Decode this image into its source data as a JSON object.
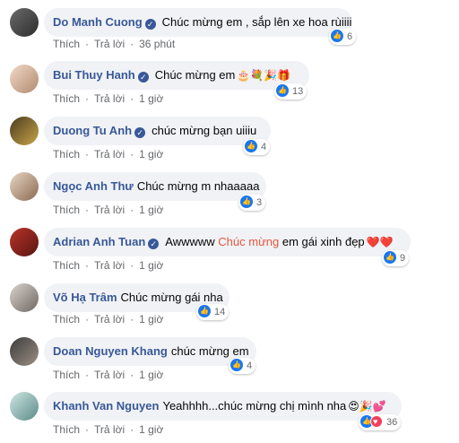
{
  "actions": {
    "like_label": "Thích",
    "reply_label": "Trả lời",
    "separator": "·"
  },
  "comments": [
    {
      "name": "Do Manh Cuong",
      "verified": true,
      "text": "Chúc mừng em , sắp lên xe hoa rùiiii",
      "emojis": "",
      "reactions": "6",
      "time": "36 phút"
    },
    {
      "name": "Bui Thuy Hanh",
      "verified": true,
      "text": "Chúc mừng em",
      "emojis": "🎂💐🎉🎁",
      "reactions": "13",
      "time": "1 giờ"
    },
    {
      "name": "Duong Tu Anh",
      "verified": true,
      "text": "chúc mừng bạn uiiiu",
      "emojis": "",
      "reactions": "4",
      "time": "1 giờ"
    },
    {
      "name": "Ngọc Anh Thư",
      "verified": false,
      "text": "Chúc mừng m nhaaaaa",
      "emojis": "",
      "reactions": "3",
      "time": "1 giờ"
    },
    {
      "name": "Adrian Anh Tuan",
      "verified": true,
      "text_before": "Awwwww",
      "text_highlight": "Chúc mừng",
      "text_after": "em gái xinh đẹp",
      "emojis": "❤️❤️",
      "reactions": "9",
      "time": "1 giờ"
    },
    {
      "name": "Võ Hạ Trâm",
      "verified": false,
      "text": "Chúc mừng gái nha",
      "emojis": "",
      "reactions": "14",
      "time": "1 giờ"
    },
    {
      "name": "Doan Nguyen Khang",
      "verified": false,
      "text": "chúc mừng em",
      "emojis": "",
      "reactions": "4",
      "time": "1 giờ"
    },
    {
      "name": "Khanh Van Nguyen",
      "verified": false,
      "text": "Yeahhhh...chúc mừng chị mình nha",
      "emojis": "😍🎉💕",
      "reactions": "36",
      "time": "1 giờ"
    }
  ],
  "colors": {
    "name": "#385898",
    "bubble": "#f0f2f5",
    "like": "#1877f2",
    "love": "#f33e58",
    "highlight": "#e9573f"
  }
}
